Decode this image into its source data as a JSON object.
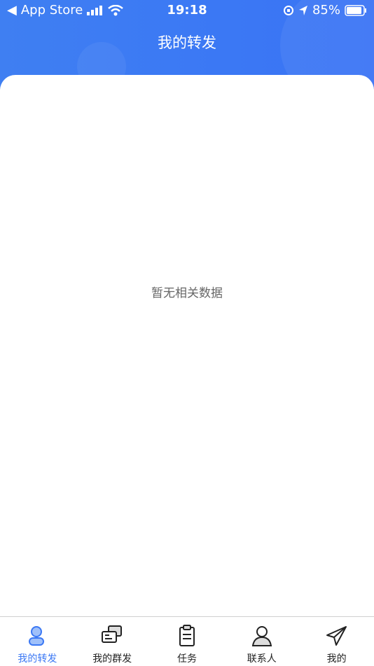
{
  "status_bar": {
    "back_app": "App Store",
    "time": "19:18",
    "battery": "85%"
  },
  "header": {
    "title": "我的转发"
  },
  "content": {
    "empty_text": "暂无相关数据"
  },
  "tabbar": {
    "active_color": "#3b78f4",
    "items": [
      {
        "label": "我的转发",
        "icon": "user-forward-icon",
        "active": true
      },
      {
        "label": "我的群发",
        "icon": "chat-cards-icon",
        "active": false
      },
      {
        "label": "任务",
        "icon": "clipboard-icon",
        "active": false
      },
      {
        "label": "联系人",
        "icon": "contact-person-icon",
        "active": false
      },
      {
        "label": "我的",
        "icon": "paper-plane-icon",
        "active": false
      }
    ]
  }
}
